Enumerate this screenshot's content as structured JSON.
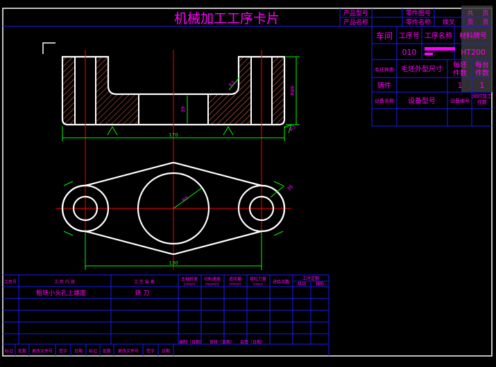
{
  "title": "机械加工工序卡片",
  "header": {
    "product_model": "产品型号",
    "product_name": "产品名称",
    "part_drawing_no": "零件图号",
    "part_name": "零件名称",
    "part_name_value": "拨叉",
    "total_label": "共",
    "page_label_1": "页",
    "page_label_2": "页",
    "page_label_3": "页"
  },
  "right_panel": {
    "workshop": "车间",
    "process_no": "工序号",
    "process_name": "工序名称",
    "material_grade": "材料牌号",
    "process_no_value": "010",
    "material_value": "HT200",
    "blank_type": "毛坯种类",
    "blank_size": "毛坯外型尺寸",
    "per_blank_count": [
      "每坯",
      "件数"
    ],
    "per_unit_count": [
      "每台",
      "件数"
    ],
    "casting": "铸件",
    "per_blank_value": "1",
    "per_unit_value": "1",
    "equipment_name": "设备名称",
    "equipment_model": "设备型号",
    "equipment_no": "设备编号",
    "simultaneous": [
      "同时加工",
      "件数"
    ]
  },
  "drawing": {
    "dim_width_top": "170",
    "dim_height_right": "R89",
    "dim_inner": "39",
    "dim_r_upper": "R3",
    "dim_r_lower": "R3",
    "dim_width_bottom": "130",
    "dim_center_radius": "R5",
    "dim_side": "38"
  },
  "process_table": {
    "headers": {
      "step_no": "工步号",
      "step_content": "工 步 内 容",
      "equipment": "工 艺 装 备",
      "spindle_speed": [
        "主轴转速",
        "(r/min)"
      ],
      "cutting_speed": [
        "切削速度",
        "(m/min)"
      ],
      "feed": [
        "进给量",
        "(mm/r)"
      ],
      "cut_depth": [
        "背吃刀量",
        "(mm)"
      ],
      "passes": "进给次数",
      "time_quota": "工时定额",
      "machine_time": "机动",
      "aux_time": "辅助"
    },
    "rows": [
      {
        "content": "粗铣小头孔上端面",
        "tool": "铣 刀"
      }
    ],
    "sign_row": [
      "编制（日期）",
      "审核（日期）",
      "会签（日期）"
    ],
    "footer": [
      "标记",
      "处数",
      "更改文件号",
      "签字",
      "日期",
      "标记",
      "处数",
      "更改文件号",
      "签字",
      "日期"
    ]
  },
  "colors": {
    "background": "#000000",
    "frame": "#ffffff",
    "table": "#1a1aff",
    "text": "#ff00ff",
    "center_line": "#ff0000",
    "dimension": "#00ff00",
    "hatch": "#ff6040"
  }
}
